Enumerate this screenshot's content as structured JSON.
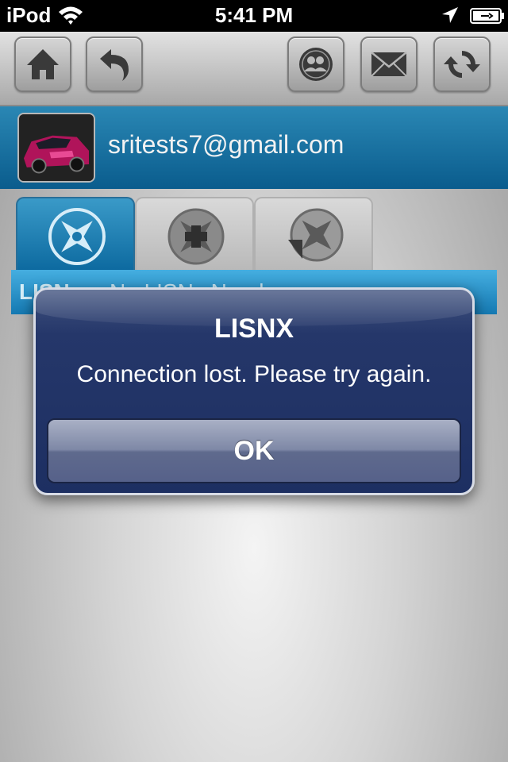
{
  "status_bar": {
    "carrier": "iPod",
    "time": "5:41 PM",
    "icons": [
      "wifi-icon",
      "location-arrow-icon",
      "battery-charging-icon"
    ]
  },
  "toolbar": {
    "left_buttons": [
      "home-icon",
      "back-arrow-icon"
    ],
    "right_buttons": [
      "people-icon",
      "mail-icon",
      "refresh-icon"
    ]
  },
  "profile": {
    "email": "sritests7@gmail.com",
    "avatar": "car-photo"
  },
  "tabs": [
    {
      "icon": "compass-x-icon",
      "active": true
    },
    {
      "icon": "compass-plus-icon",
      "active": false
    },
    {
      "icon": "compass-refresh-icon",
      "active": false
    }
  ],
  "lisns": {
    "label": "LISNs:",
    "value": "No LISNs Nearby"
  },
  "alert": {
    "title": "LISNX",
    "message": "Connection lost. Please try again.",
    "button": "OK"
  },
  "colors": {
    "header_blue": "#0a5c8d",
    "alert_navy": "#1d2f62",
    "toolbar_gray": "#a8a8a8"
  }
}
